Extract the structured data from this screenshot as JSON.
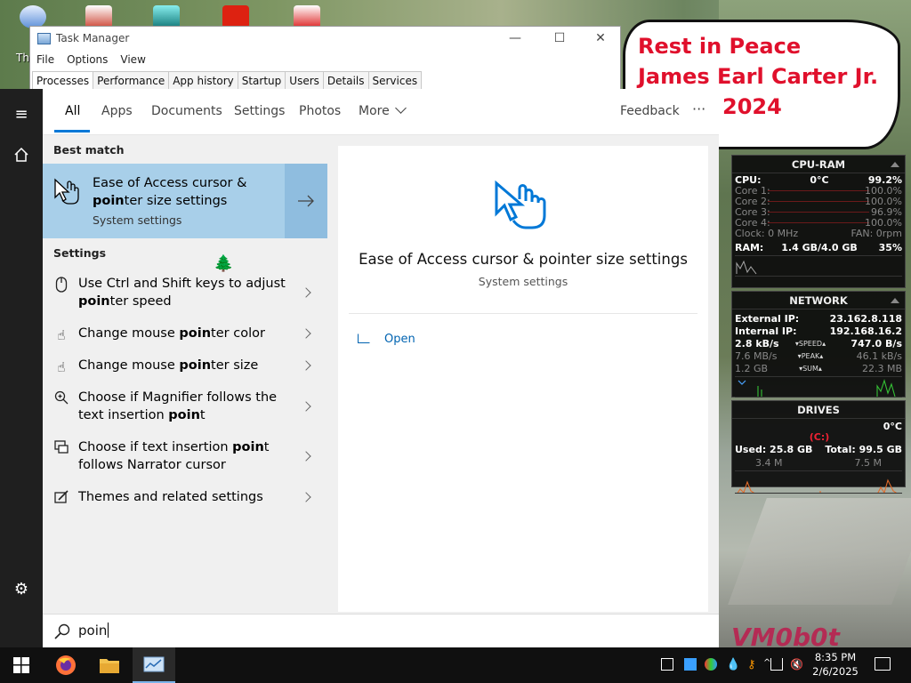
{
  "desktop": {
    "label_th": "Th",
    "note_lines": [
      "Rest in Peace",
      "James Earl Carter Jr.",
      "2024"
    ],
    "watermark": "VM0b0t"
  },
  "task_manager": {
    "title": "Task Manager",
    "menu": [
      "File",
      "Options",
      "View"
    ],
    "tabs": [
      "Processes",
      "Performance",
      "App history",
      "Startup",
      "Users",
      "Details",
      "Services"
    ],
    "active_tab": "Processes"
  },
  "search": {
    "tabs": [
      "All",
      "Apps",
      "Documents",
      "Settings",
      "Photos",
      "More"
    ],
    "active_tab": "All",
    "feedback_label": "Feedback",
    "overflow_label": "···",
    "best_match_heading": "Best match",
    "best_match": {
      "title_line1": "Ease of Access cursor &",
      "title_line2_bold": "poin",
      "title_line2_rest": "ter size settings",
      "subtitle": "System settings",
      "icon": "pointer-hand-icon"
    },
    "settings_heading": "Settings",
    "results": [
      {
        "icon": "mouse-icon",
        "pre": "Use Ctrl and Shift keys to adjust",
        "bold": "poin",
        "post": "ter speed"
      },
      {
        "icon": "pointer-color-icon",
        "pre": "Change mouse ",
        "bold": "poin",
        "post": "ter color"
      },
      {
        "icon": "pointer-size-icon",
        "pre": "Change mouse ",
        "bold": "poin",
        "post": "ter size"
      },
      {
        "icon": "magnifier-icon",
        "pre": "Choose if Magnifier follows the text insertion ",
        "bold": "poin",
        "post": "t"
      },
      {
        "icon": "narrator-icon",
        "pre": "Choose if text insertion ",
        "bold": "poin",
        "post": "t follows Narrator cursor"
      },
      {
        "icon": "themes-icon",
        "pre": "Themes and related settings",
        "bold": "",
        "post": ""
      }
    ],
    "preview": {
      "title": "Ease of Access cursor & pointer size settings",
      "subtitle": "System settings",
      "open_label": "Open"
    },
    "query": "poin"
  },
  "gadgets": {
    "cpu_ram": {
      "title": "CPU-RAM",
      "cpu_label": "CPU:",
      "cpu_temp": "0°C",
      "cpu_value": "99.2%",
      "cores": [
        {
          "label": "Core 1:",
          "value": "100.0%"
        },
        {
          "label": "Core 2:",
          "value": "100.0%"
        },
        {
          "label": "Core 3:",
          "value": "96.9%"
        },
        {
          "label": "Core 4:",
          "value": "100.0%"
        }
      ],
      "clock": "Clock: 0 MHz",
      "fan": "FAN: 0rpm",
      "ram_label": "RAM:",
      "ram_value": "1.4 GB/4.0 GB",
      "ram_pct": "35%"
    },
    "network": {
      "title": "NETWORK",
      "external_label": "External IP:",
      "external_ip": "23.162.8.118",
      "internal_label": "Internal IP:",
      "internal_ip": "192.168.16.2",
      "speed_down": "2.8 kB/s",
      "speed_label": "▾SPEED▴",
      "speed_up": "747.0 B/s",
      "peak_down": "7.6 MB/s",
      "peak_label": "▾PEAK▴",
      "peak_up": "46.1 kB/s",
      "sum_down": "1.2 GB",
      "sum_label": "▾SUM▴",
      "sum_up": "22.3 MB"
    },
    "drives": {
      "title": "DRIVES",
      "drive": "(C:)",
      "temp": "0°C",
      "used": "Used: 25.8 GB",
      "total": "Total: 99.5 GB",
      "read": "3.4 M",
      "write": "7.5 M"
    }
  },
  "taskbar": {
    "time": "8:35 PM",
    "date": "2/6/2025"
  },
  "colors": {
    "accent": "#0078d7",
    "best_match_bg": "#a8cfe9",
    "note_text": "#e0102c"
  }
}
